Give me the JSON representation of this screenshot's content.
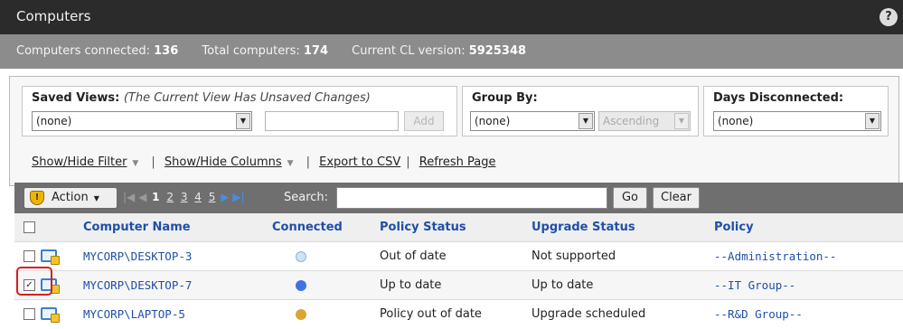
{
  "window": {
    "title": "Computers",
    "help": "?"
  },
  "stats": {
    "connected_label": "Computers connected:",
    "connected_value": "136",
    "total_label": "Total computers:",
    "total_value": "174",
    "cl_label": "Current CL version:",
    "cl_value": "5925348"
  },
  "filters": {
    "saved_views": {
      "label": "Saved Views:",
      "note": "(The Current View Has Unsaved Changes)",
      "value": "(none)",
      "name_value": "",
      "add_label": "Add"
    },
    "group_by": {
      "label": "Group By:",
      "value": "(none)",
      "order_value": "Ascending"
    },
    "days_disconnected": {
      "label": "Days Disconnected:",
      "value": "(none)"
    },
    "links": {
      "show_hide_filter": "Show/Hide Filter",
      "show_hide_columns": "Show/Hide Columns",
      "sep": "|",
      "export_csv": "Export to CSV",
      "refresh": "Refresh Page"
    }
  },
  "toolbar": {
    "action_label": "Action",
    "pager": {
      "first": "|◀",
      "prev": "◀",
      "pages": [
        "1",
        "2",
        "3",
        "4",
        "5"
      ],
      "next": "▶",
      "last": "▶|"
    },
    "search_label": "Search:",
    "search_value": "",
    "go_label": "Go",
    "clear_label": "Clear"
  },
  "table": {
    "columns": [
      "Computer Name",
      "Connected",
      "Policy Status",
      "Upgrade Status",
      "Policy"
    ],
    "rows": [
      {
        "checked": false,
        "name": "MYCORP\\DESKTOP-3",
        "connected": "not-connected",
        "policy_status": "Out of date",
        "upgrade_status": "Not supported",
        "policy": "--Administration--"
      },
      {
        "checked": true,
        "name": "MYCORP\\DESKTOP-7",
        "connected": "connected",
        "policy_status": "Up to date",
        "upgrade_status": "Up to date",
        "policy": "--IT Group--"
      },
      {
        "checked": false,
        "name": "MYCORP\\LAPTOP-5",
        "connected": "disconnected",
        "policy_status": "Policy out of date",
        "upgrade_status": "Upgrade scheduled",
        "policy": "--R&D Group--"
      }
    ]
  },
  "colors": {
    "not_connected": "#cfe3f7",
    "connected": "#3f74e0",
    "disconnected": "#d9a535",
    "link": "#1f4fa8",
    "highlight": "#d81e1e"
  }
}
